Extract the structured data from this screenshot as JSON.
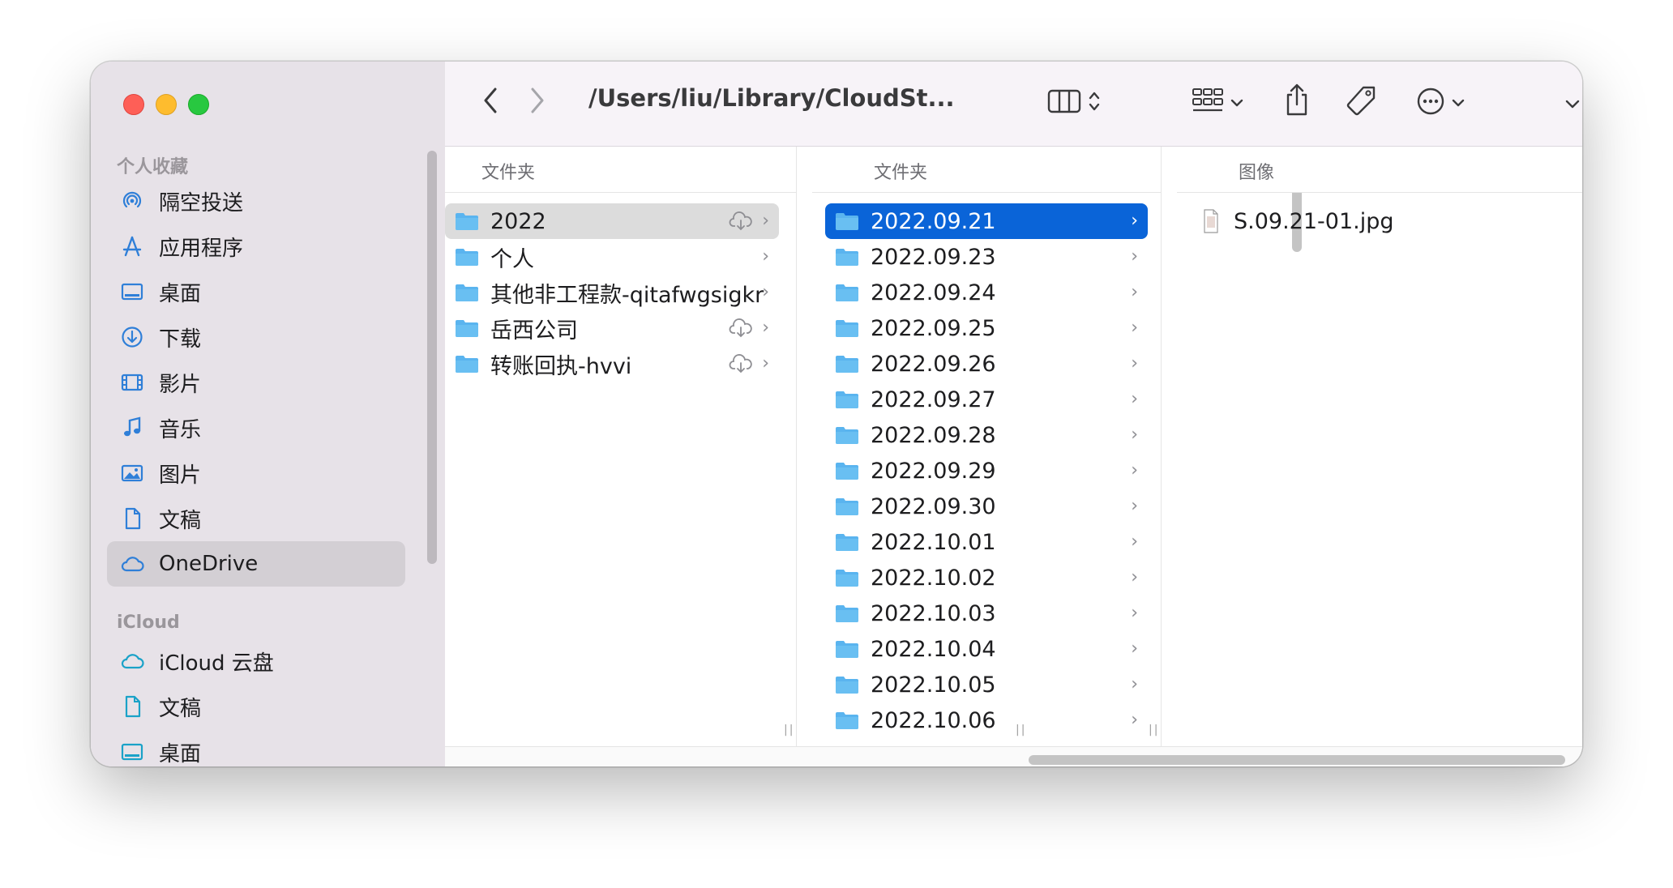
{
  "sidebar": {
    "favorites_header": "个人收藏",
    "favorites": [
      {
        "label": "隔空投送",
        "icon": "airdrop-icon"
      },
      {
        "label": "应用程序",
        "icon": "applications-icon"
      },
      {
        "label": "桌面",
        "icon": "desktop-icon"
      },
      {
        "label": "下载",
        "icon": "downloads-icon"
      },
      {
        "label": "影片",
        "icon": "movies-icon"
      },
      {
        "label": "音乐",
        "icon": "music-icon"
      },
      {
        "label": "图片",
        "icon": "pictures-icon"
      },
      {
        "label": "文稿",
        "icon": "documents-icon"
      },
      {
        "label": "OneDrive",
        "icon": "cloud-icon",
        "selected": true
      }
    ],
    "icloud_header": "iCloud",
    "icloud": [
      {
        "label": "iCloud 云盘",
        "icon": "icloud-drive-icon"
      },
      {
        "label": "文稿",
        "icon": "documents-icon"
      },
      {
        "label": "桌面",
        "icon": "desktop-icon"
      }
    ]
  },
  "toolbar": {
    "path": "/Users/liu/Library/CloudSt..."
  },
  "columns": [
    {
      "header": "文件夹",
      "items": [
        {
          "label": "2022",
          "cloud": true,
          "selected": "grey"
        },
        {
          "label": "个人",
          "cloud": false
        },
        {
          "label": "其他非工程款-qitafwgsigkr",
          "cloud": false
        },
        {
          "label": "岳西公司",
          "cloud": true
        },
        {
          "label": "转账回执-hvvi",
          "cloud": true
        }
      ]
    },
    {
      "header": "文件夹",
      "items": [
        {
          "label": "2022.09.21",
          "selected": "blue"
        },
        {
          "label": "2022.09.23"
        },
        {
          "label": "2022.09.24"
        },
        {
          "label": "2022.09.25"
        },
        {
          "label": "2022.09.26"
        },
        {
          "label": "2022.09.27"
        },
        {
          "label": "2022.09.28"
        },
        {
          "label": "2022.09.29"
        },
        {
          "label": "2022.09.30"
        },
        {
          "label": "2022.10.01"
        },
        {
          "label": "2022.10.02"
        },
        {
          "label": "2022.10.03"
        },
        {
          "label": "2022.10.04"
        },
        {
          "label": "2022.10.05"
        },
        {
          "label": "2022.10.06"
        }
      ]
    },
    {
      "header": "图像",
      "items": [
        {
          "label": "S.09.21-01.jpg"
        }
      ]
    }
  ],
  "colors": {
    "accent": "#0a64d8",
    "folder": "#5ab4ef",
    "sidebar_icon": "#2f7fd8"
  }
}
